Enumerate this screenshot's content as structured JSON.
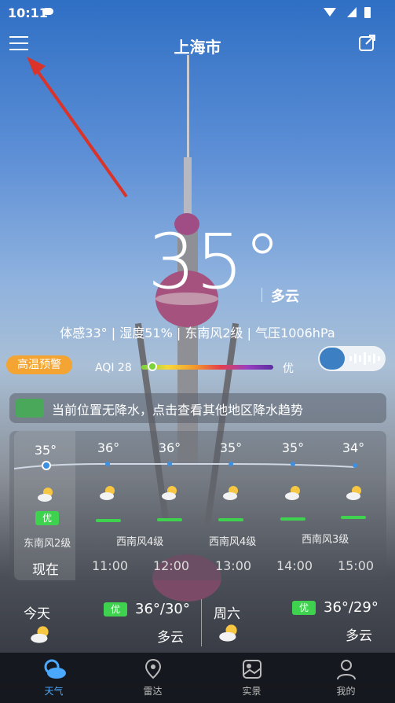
{
  "status_bar": {
    "time": "10:11"
  },
  "header": {
    "city": "上海市"
  },
  "current": {
    "temp": "35°",
    "condition": "多云",
    "details": "体感33° | 湿度51% | 东南风2级 | 气压1006hPa"
  },
  "warning": {
    "label": "高温预警"
  },
  "aqi": {
    "label": "AQI 28",
    "level": "优",
    "value": 28
  },
  "notice": {
    "text": "当前位置无降水，点击查看其他地区降水趋势"
  },
  "forecast": {
    "hours": [
      {
        "temp": "35°",
        "time": "现在",
        "aq": "优"
      },
      {
        "temp": "36°",
        "time": "11:00"
      },
      {
        "temp": "36°",
        "time": "12:00"
      },
      {
        "temp": "35°",
        "time": "13:00"
      },
      {
        "temp": "35°",
        "time": "14:00"
      },
      {
        "temp": "34°",
        "time": "15:00"
      }
    ],
    "winds": [
      "东南风2级",
      "西南风4级",
      "西南风4级",
      "西南风3级"
    ]
  },
  "days": [
    {
      "title": "今天",
      "aq": "优",
      "temps": "36°/30°",
      "condition": "多云"
    },
    {
      "title": "周六",
      "aq": "优",
      "temps": "36°/29°",
      "condition": "多云"
    }
  ],
  "tabs": [
    {
      "label": "天气",
      "icon": "weather-icon"
    },
    {
      "label": "雷达",
      "icon": "location-pin-icon"
    },
    {
      "label": "实景",
      "icon": "photo-icon"
    },
    {
      "label": "我的",
      "icon": "person-icon"
    }
  ],
  "colors": {
    "accent": "#4aa8ff",
    "warning": "#f3a433",
    "aq_good": "#3fd24e"
  }
}
